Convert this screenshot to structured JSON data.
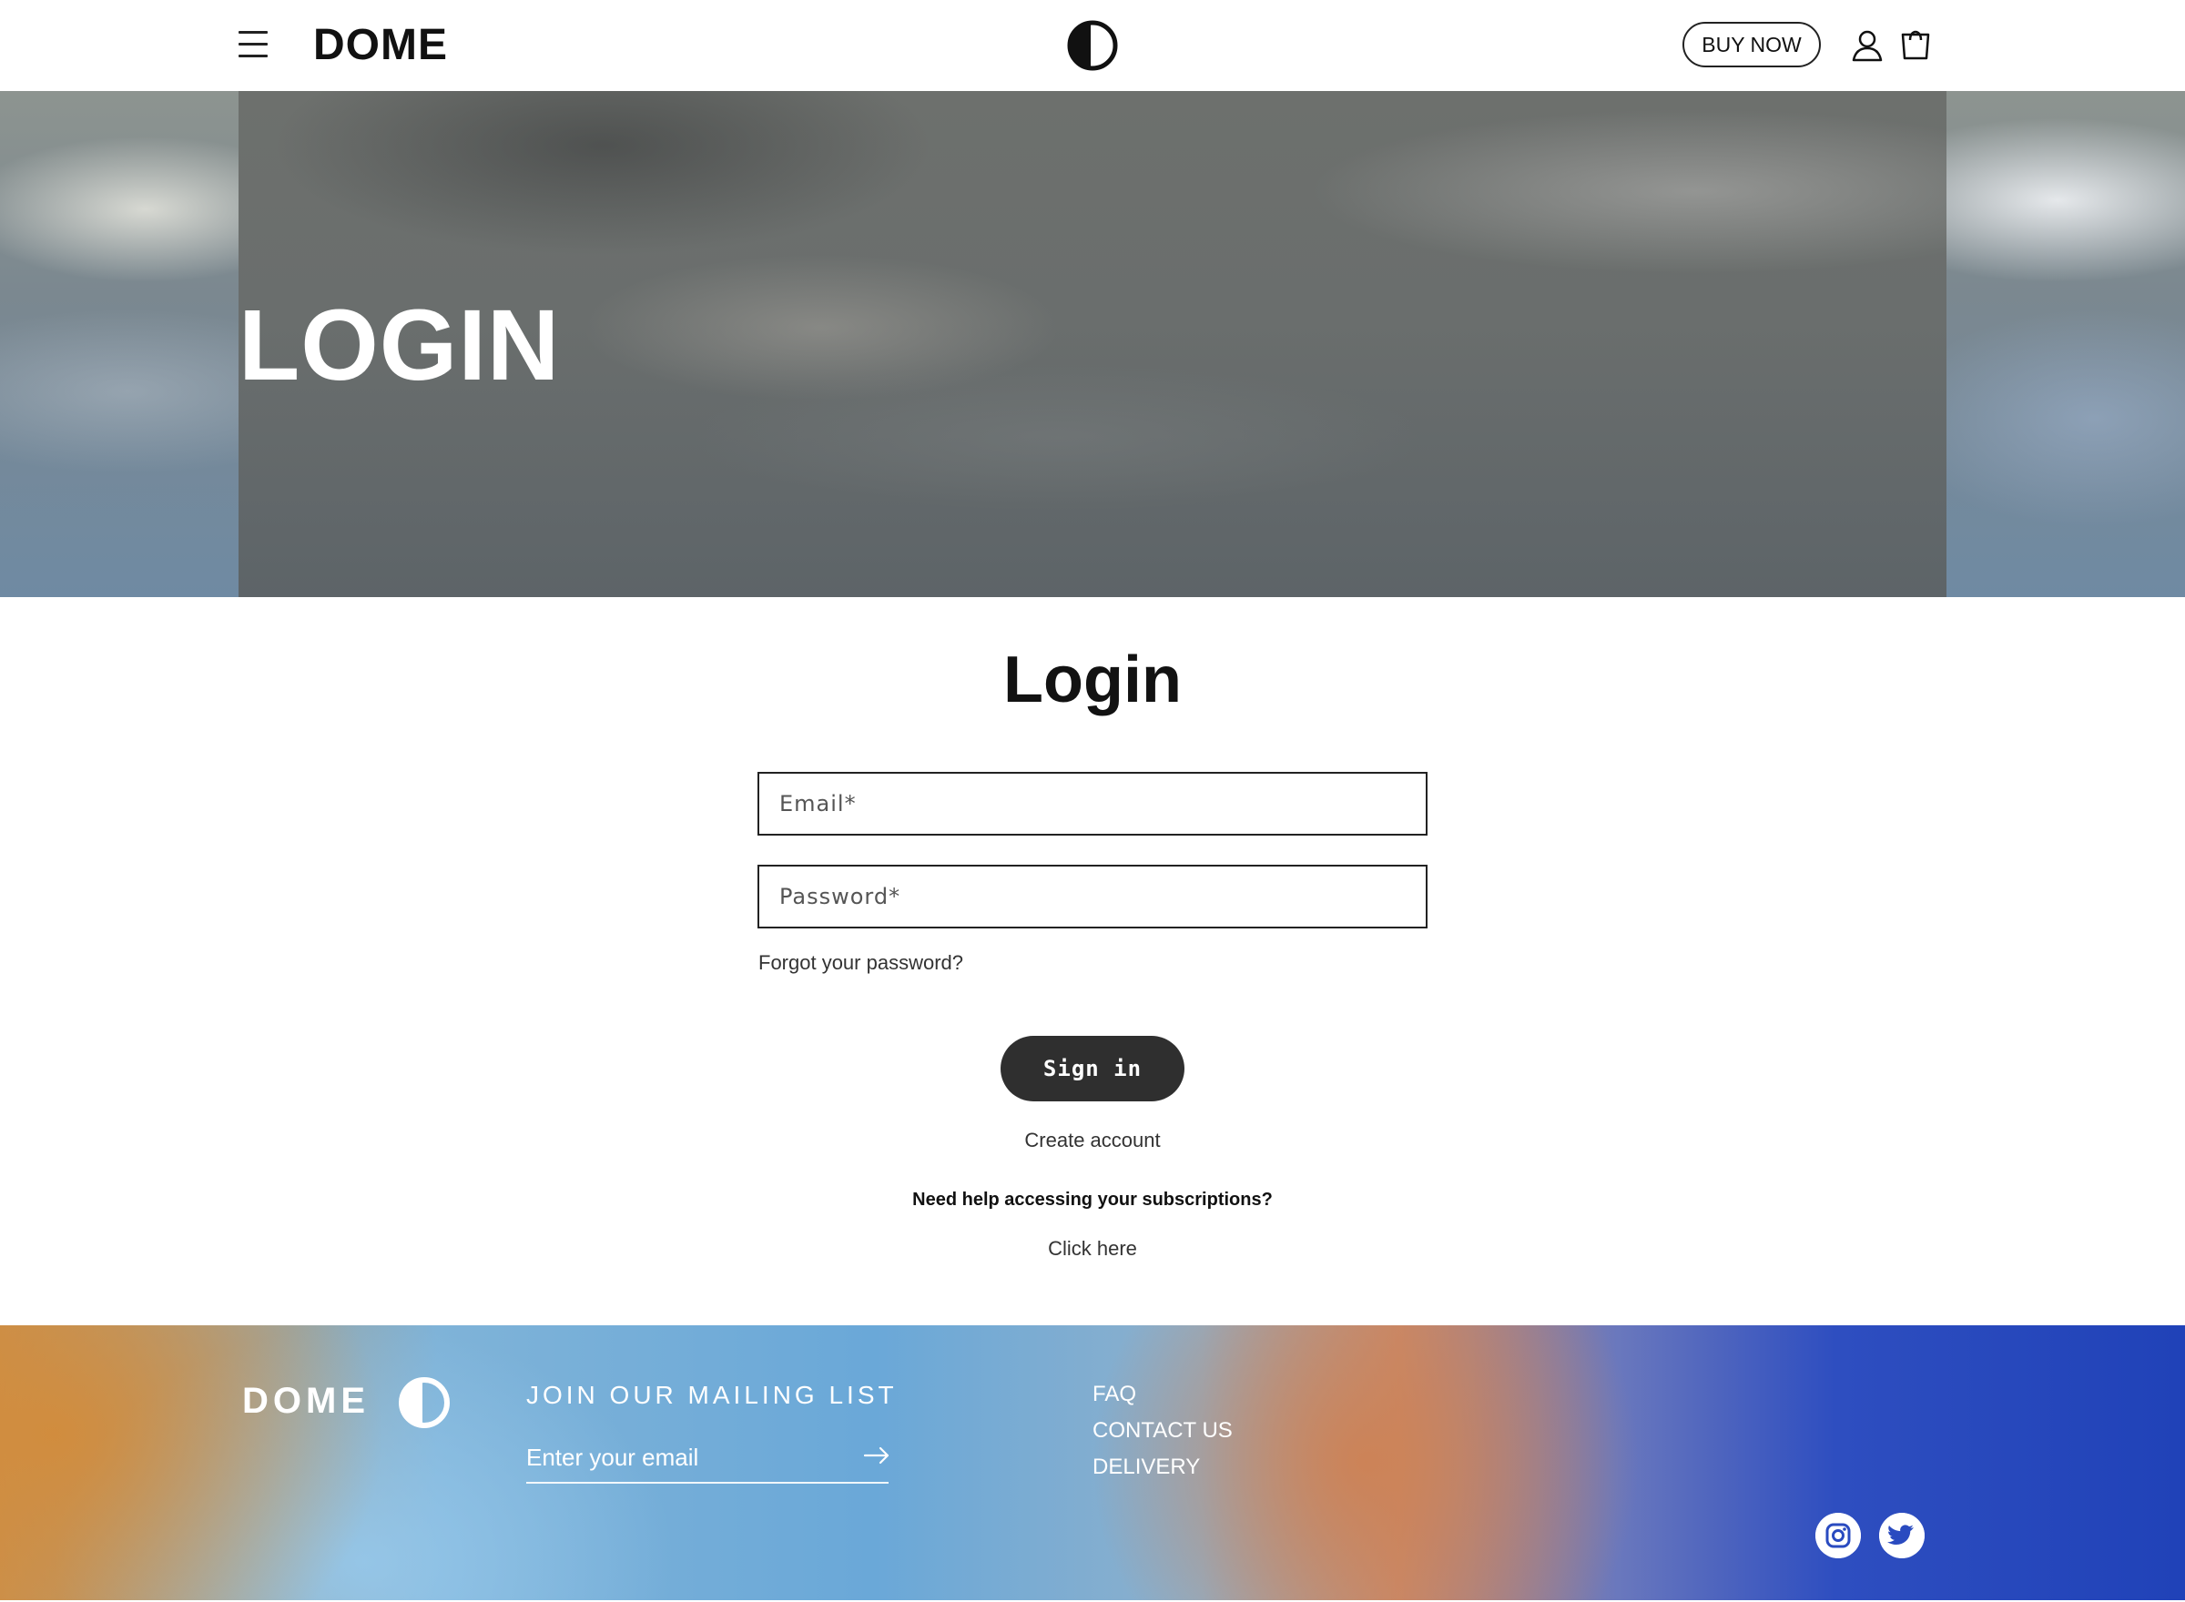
{
  "header": {
    "brand": "DOME",
    "buy_now_label": "BUY NOW"
  },
  "hero": {
    "title": "LOGIN"
  },
  "login": {
    "heading": "Login",
    "email_placeholder": "Email*",
    "password_placeholder": "Password*",
    "forgot_password": "Forgot your password?",
    "sign_in_label": "Sign in",
    "create_account": "Create account",
    "help_heading": "Need help accessing your subscriptions?",
    "help_link": "Click here"
  },
  "footer": {
    "brand": "DOME",
    "mailing_heading": "JOIN OUR MAILING LIST",
    "mailing_placeholder": "Enter your email",
    "links": [
      "FAQ",
      "CONTACT US",
      "DELIVERY"
    ],
    "social": [
      "instagram-icon",
      "twitter-icon"
    ]
  },
  "colors": {
    "button_dark": "#2f2f2f",
    "text": "#121212",
    "footer_blue": "#2042b8",
    "footer_orange": "#c9914f"
  }
}
